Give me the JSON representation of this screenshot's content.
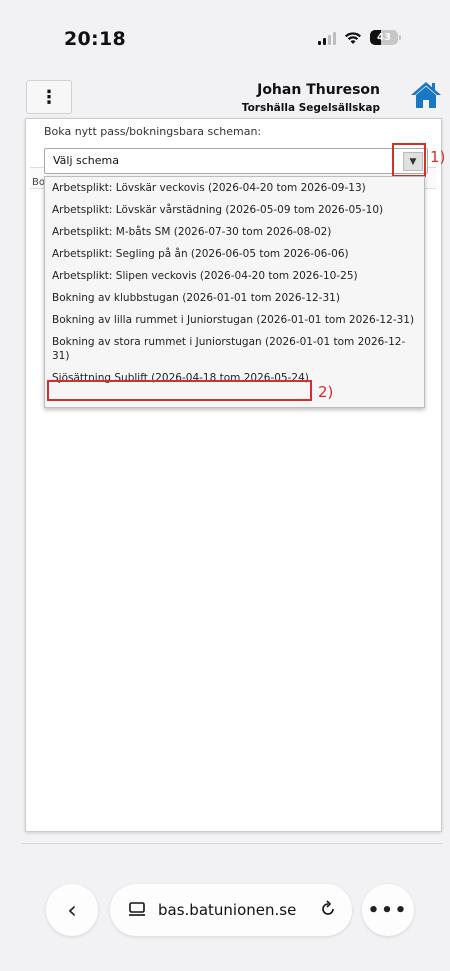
{
  "status_bar": {
    "time": "20:18",
    "battery": "43"
  },
  "header": {
    "menu_glyph": "⋮",
    "user_name": "Johan Thureson",
    "org_name": "Torshälla Segelsällskap",
    "home_icon_color": "#1a78c2"
  },
  "panel": {
    "label": "Boka nytt pass/bokningsbara scheman:",
    "behind_text": "Bo",
    "select": {
      "value": "Välj schema",
      "arrow": "▼"
    }
  },
  "dropdown": {
    "options": [
      "Arbetsplikt: Lövskär veckovis (2026-04-20 tom 2026-09-13)",
      "Arbetsplikt: Lövskär vårstädning (2026-05-09 tom 2026-05-10)",
      "Arbetsplikt: M-båts SM (2026-07-30 tom 2026-08-02)",
      "Arbetsplikt: Segling på ån (2026-06-05 tom 2026-06-06)",
      "Arbetsplikt: Slipen veckovis (2026-04-20 tom 2026-10-25)",
      "Bokning av klubbstugan (2026-01-01 tom 2026-12-31)",
      "Bokning av lilla rummet i Juniorstugan (2026-01-01 tom 2026-12-31)",
      "Bokning av stora rummet i Juniorstugan (2026-01-01 tom 2026-12-31)",
      "Sjösättning Sublift (2026-04-18 tom 2026-05-24)"
    ]
  },
  "annotations": {
    "one": "1)",
    "two": "2)",
    "color": "#d32f2f"
  },
  "browser": {
    "back_glyph": "‹",
    "url": "bas.batunionen.se",
    "more_glyph": "•••"
  }
}
